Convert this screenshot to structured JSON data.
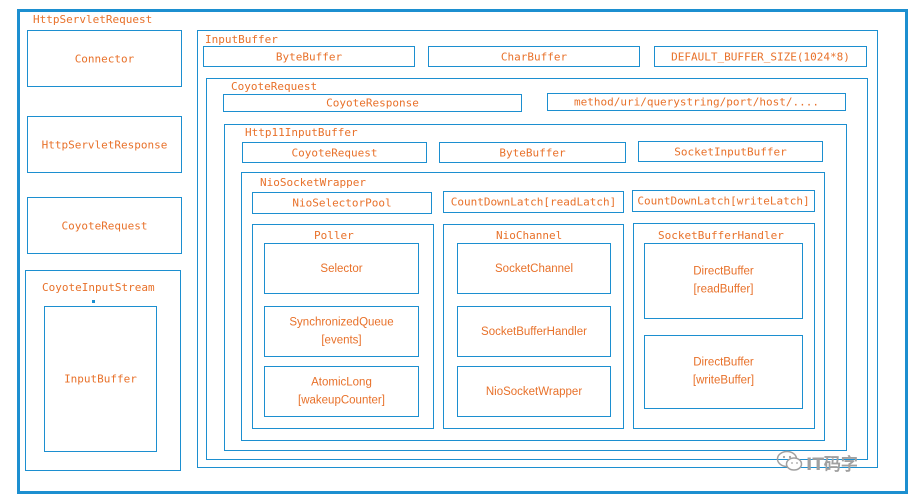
{
  "http_servlet_request": "HttpServletRequest",
  "connector": "Connector",
  "http_servlet_response": "HttpServletResponse",
  "coyote_request_left": "CoyoteRequest",
  "coyote_input_stream": "CoyoteInputStream",
  "input_buffer_inner": "InputBuffer",
  "input_buffer": "InputBuffer",
  "byte_buffer_top": "ByteBuffer",
  "char_buffer": "CharBuffer",
  "default_buffer_size": "DEFAULT_BUFFER_SIZE(1024*8)",
  "coyote_request": "CoyoteRequest",
  "coyote_response": "CoyoteResponse",
  "method_uri": "method/uri/querystring/port/host/....",
  "http11_input_buffer": "Http11InputBuffer",
  "http11_coyote_request": "CoyoteRequest",
  "http11_byte_buffer": "ByteBuffer",
  "socket_input_buffer": "SocketInputBuffer",
  "nio_socket_wrapper": "NioSocketWrapper",
  "nio_selector_pool": "NioSelectorPool",
  "read_latch": "CountDownLatch[readLatch]",
  "write_latch": "CountDownLatch[writeLatch]",
  "poller": {
    "title": "Poller",
    "selector": "Selector",
    "sync_queue": [
      "SynchronizedQueue",
      "[events]"
    ],
    "atomic_long": [
      "AtomicLong",
      "[wakeupCounter]"
    ]
  },
  "nio_channel": {
    "title": "NioChannel",
    "socket_channel": "SocketChannel",
    "socket_buffer_handler": "SocketBufferHandler",
    "nio_socket_wrapper": "NioSocketWrapper"
  },
  "socket_buffer_handler_panel": {
    "title": "SocketBufferHandler",
    "read_buffer": [
      "DirectBuffer",
      "[readBuffer]"
    ],
    "write_buffer": [
      "DirectBuffer",
      "[writeBuffer]"
    ]
  },
  "watermark": "IT码字",
  "colors": {
    "border": "#1c8fd0",
    "text": "#e8712a"
  }
}
